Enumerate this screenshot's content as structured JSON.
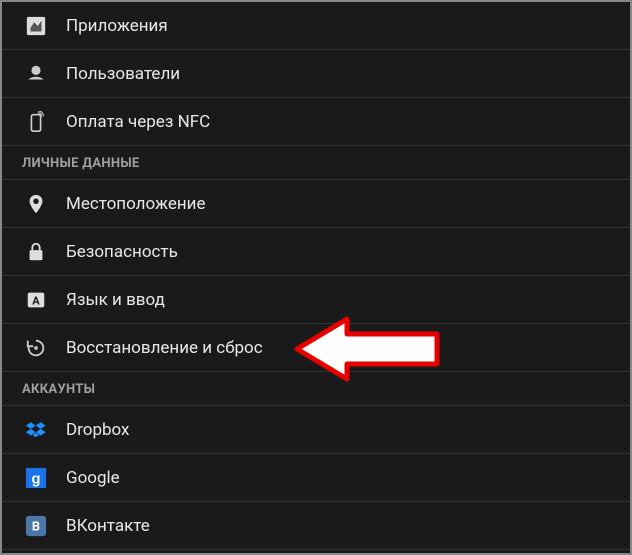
{
  "items": {
    "apps": {
      "label": "Приложения"
    },
    "users": {
      "label": "Пользователи"
    },
    "nfc": {
      "label": "Оплата через NFC"
    }
  },
  "personal": {
    "header": "ЛИЧНЫЕ ДАННЫЕ",
    "location": {
      "label": "Местоположение"
    },
    "security": {
      "label": "Безопасность"
    },
    "language": {
      "label": "Язык и ввод"
    },
    "backup": {
      "label": "Восстановление и сброс"
    }
  },
  "accounts": {
    "header": "АККАУНТЫ",
    "dropbox": {
      "label": "Dropbox"
    },
    "google": {
      "label": "Google"
    },
    "vk": {
      "label": "ВКонтакте"
    }
  }
}
